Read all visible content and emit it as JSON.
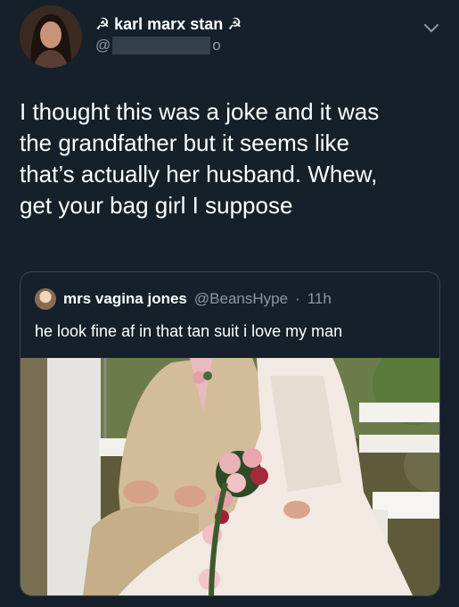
{
  "author": {
    "display_name": "☭ karl marx stan ☭",
    "handle_prefix": "@",
    "handle_suffix": "o"
  },
  "tweet": {
    "text": "I thought this was a joke and it was\nthe grandfather but it seems like\nthat’s actually her husband. Whew,\nget your bag girl I suppose"
  },
  "quoted_tweet": {
    "display_name": "mrs vagina jones",
    "handle": "@BeansHype",
    "separator": "·",
    "time": "11h",
    "text": "he look fine af in that tan suit i love my man"
  },
  "colors": {
    "background": "#15202b",
    "secondary_text": "#8899a6",
    "border": "#38444d"
  },
  "icons": {
    "menu": "chevron-down-icon"
  }
}
